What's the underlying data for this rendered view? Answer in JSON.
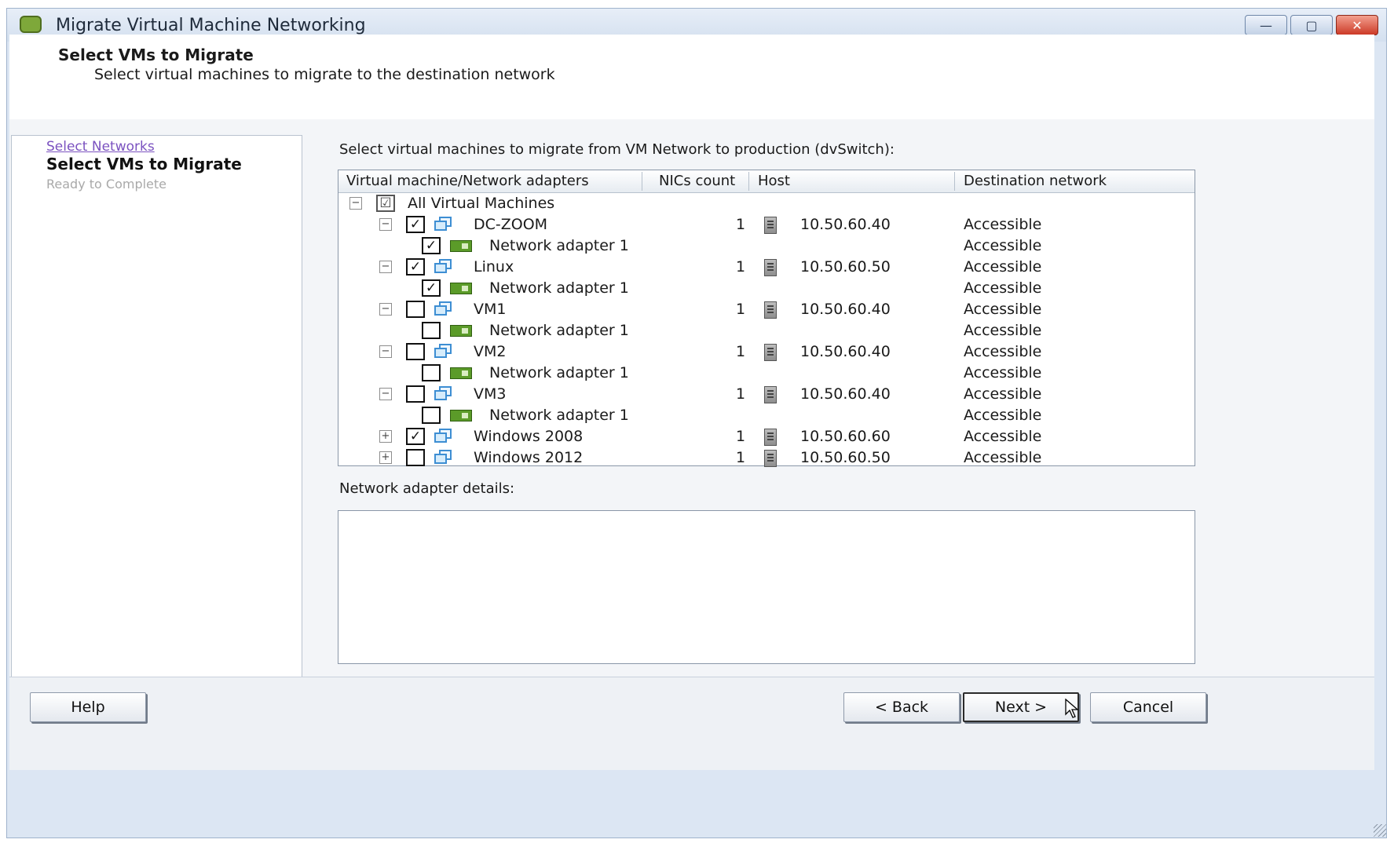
{
  "window": {
    "title": "Migrate Virtual Machine Networking",
    "controls": {
      "minimize": "—",
      "maximize": "▢",
      "close": "✕"
    }
  },
  "header": {
    "title": "Select VMs to Migrate",
    "subtitle": "Select virtual machines to migrate to the destination network"
  },
  "nav": {
    "step1": "Select Networks",
    "step2": "Select VMs to Migrate",
    "step3": "Ready to Complete"
  },
  "instruction": "Select virtual machines to migrate from VM Network to production (dvSwitch):",
  "table": {
    "columns": {
      "name": "Virtual machine/Network adapters",
      "nics": "NICs count",
      "host": "Host",
      "dest": "Destination network"
    },
    "root": {
      "label": "All Virtual Machines",
      "toggle": "−",
      "checked": "☑"
    },
    "rows": [
      {
        "name": "DC-ZOOM",
        "nics": "1",
        "host": "10.50.60.40",
        "dest": "Accessible",
        "checked": "✓",
        "toggle": "−"
      },
      {
        "name": "Network adapter 1",
        "dest": "Accessible",
        "checked": "✓"
      },
      {
        "name": "Linux",
        "nics": "1",
        "host": "10.50.60.50",
        "dest": "Accessible",
        "checked": "✓",
        "toggle": "−"
      },
      {
        "name": "Network adapter 1",
        "dest": "Accessible",
        "checked": "✓"
      },
      {
        "name": "VM1",
        "nics": "1",
        "host": "10.50.60.40",
        "dest": "Accessible",
        "checked": "",
        "toggle": "−"
      },
      {
        "name": "Network adapter 1",
        "dest": "Accessible",
        "checked": ""
      },
      {
        "name": "VM2",
        "nics": "1",
        "host": "10.50.60.40",
        "dest": "Accessible",
        "checked": "",
        "toggle": "−"
      },
      {
        "name": "Network adapter 1",
        "dest": "Accessible",
        "checked": ""
      },
      {
        "name": "VM3",
        "nics": "1",
        "host": "10.50.60.40",
        "dest": "Accessible",
        "checked": "",
        "toggle": "−"
      },
      {
        "name": "Network adapter 1",
        "dest": "Accessible",
        "checked": ""
      },
      {
        "name": "Windows 2008",
        "nics": "1",
        "host": "10.50.60.60",
        "dest": "Accessible",
        "checked": "✓",
        "toggle": "+"
      },
      {
        "name": "Windows 2012",
        "nics": "1",
        "host": "10.50.60.50",
        "dest": "Accessible",
        "checked": "",
        "toggle": "+"
      }
    ]
  },
  "details": {
    "label": "Network adapter details:"
  },
  "buttons": {
    "help": "Help",
    "back": "< Back",
    "next": "Next >",
    "cancel": "Cancel"
  }
}
